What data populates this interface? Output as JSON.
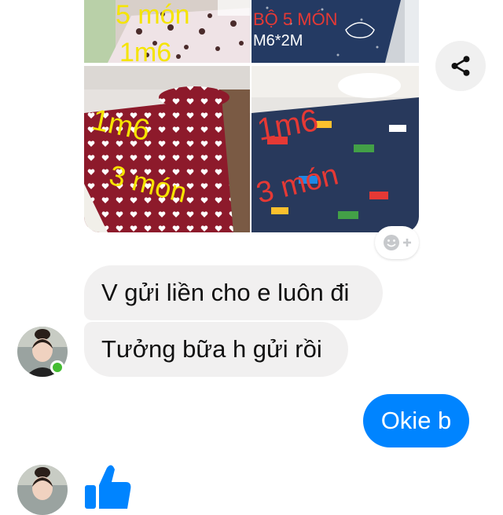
{
  "photos": [
    {
      "caption_line1": "5 món",
      "caption_line2": "1m6",
      "theme": "leopard"
    },
    {
      "caption_line1": "BỘ 5 MÓN",
      "caption_line2": "M6*2M",
      "theme": "navy-whale"
    },
    {
      "caption_line1": "1m6",
      "caption_line2": "3 món",
      "theme": "red-hearts"
    },
    {
      "caption_line1": "1m6",
      "caption_line2": "3 món",
      "theme": "navy-cars"
    }
  ],
  "messages": [
    {
      "side": "incoming",
      "text": "V gửi liền cho e luôn đi"
    },
    {
      "side": "incoming",
      "text": "Tưởng bữa h gửi rồi"
    },
    {
      "side": "outgoing",
      "text": "Okie b"
    }
  ],
  "icons": {
    "share": "share-icon",
    "react": "add-reaction-icon",
    "like": "thumbs-up-icon"
  },
  "colors": {
    "outgoing_bubble": "#0084ff",
    "incoming_bubble": "#f1f0f0",
    "online": "#44bd32",
    "like": "#0084ff"
  }
}
